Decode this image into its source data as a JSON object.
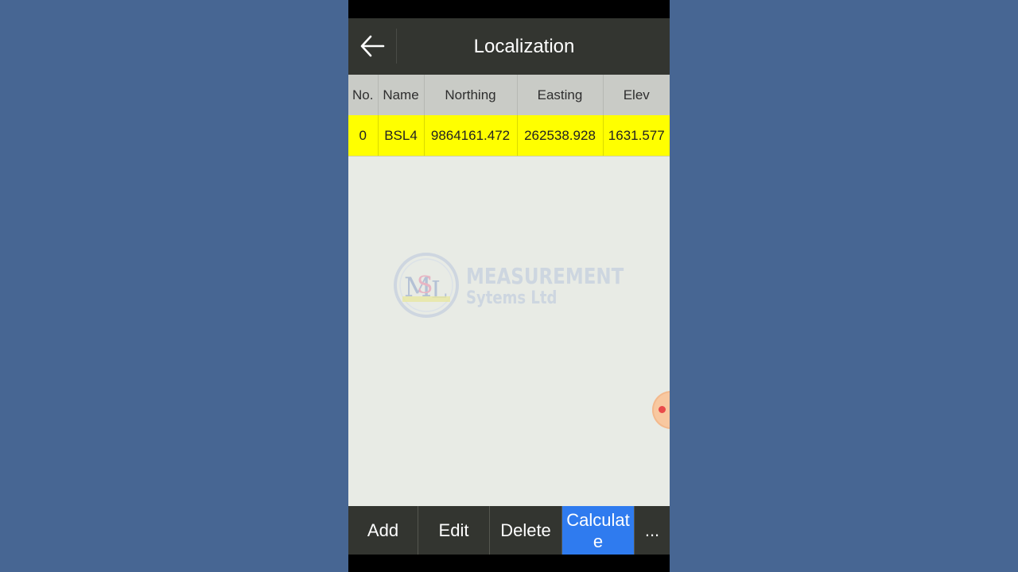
{
  "app_bar": {
    "title": "Localization",
    "back_icon": "arrow-left-icon"
  },
  "table": {
    "columns": [
      "No.",
      "Name",
      "Northing",
      "Easting",
      "Elev"
    ],
    "rows": [
      [
        "0",
        "BSL4",
        "9864161.472",
        "262538.928",
        "1631.577"
      ]
    ],
    "selected_row_color": "#ffff00"
  },
  "watermark": {
    "line1": "MEASUREMENT",
    "line2": "Sytems Ltd",
    "logo_letters": "MSL"
  },
  "toolbar": {
    "add_label": "Add",
    "edit_label": "Edit",
    "delete_label": "Delete",
    "calculate_label": "Calculate",
    "more_label": "..."
  },
  "colors": {
    "background": "#476693",
    "app_bar": "#333530",
    "accent": "#2f7bef",
    "content": "#e8ebe5"
  }
}
